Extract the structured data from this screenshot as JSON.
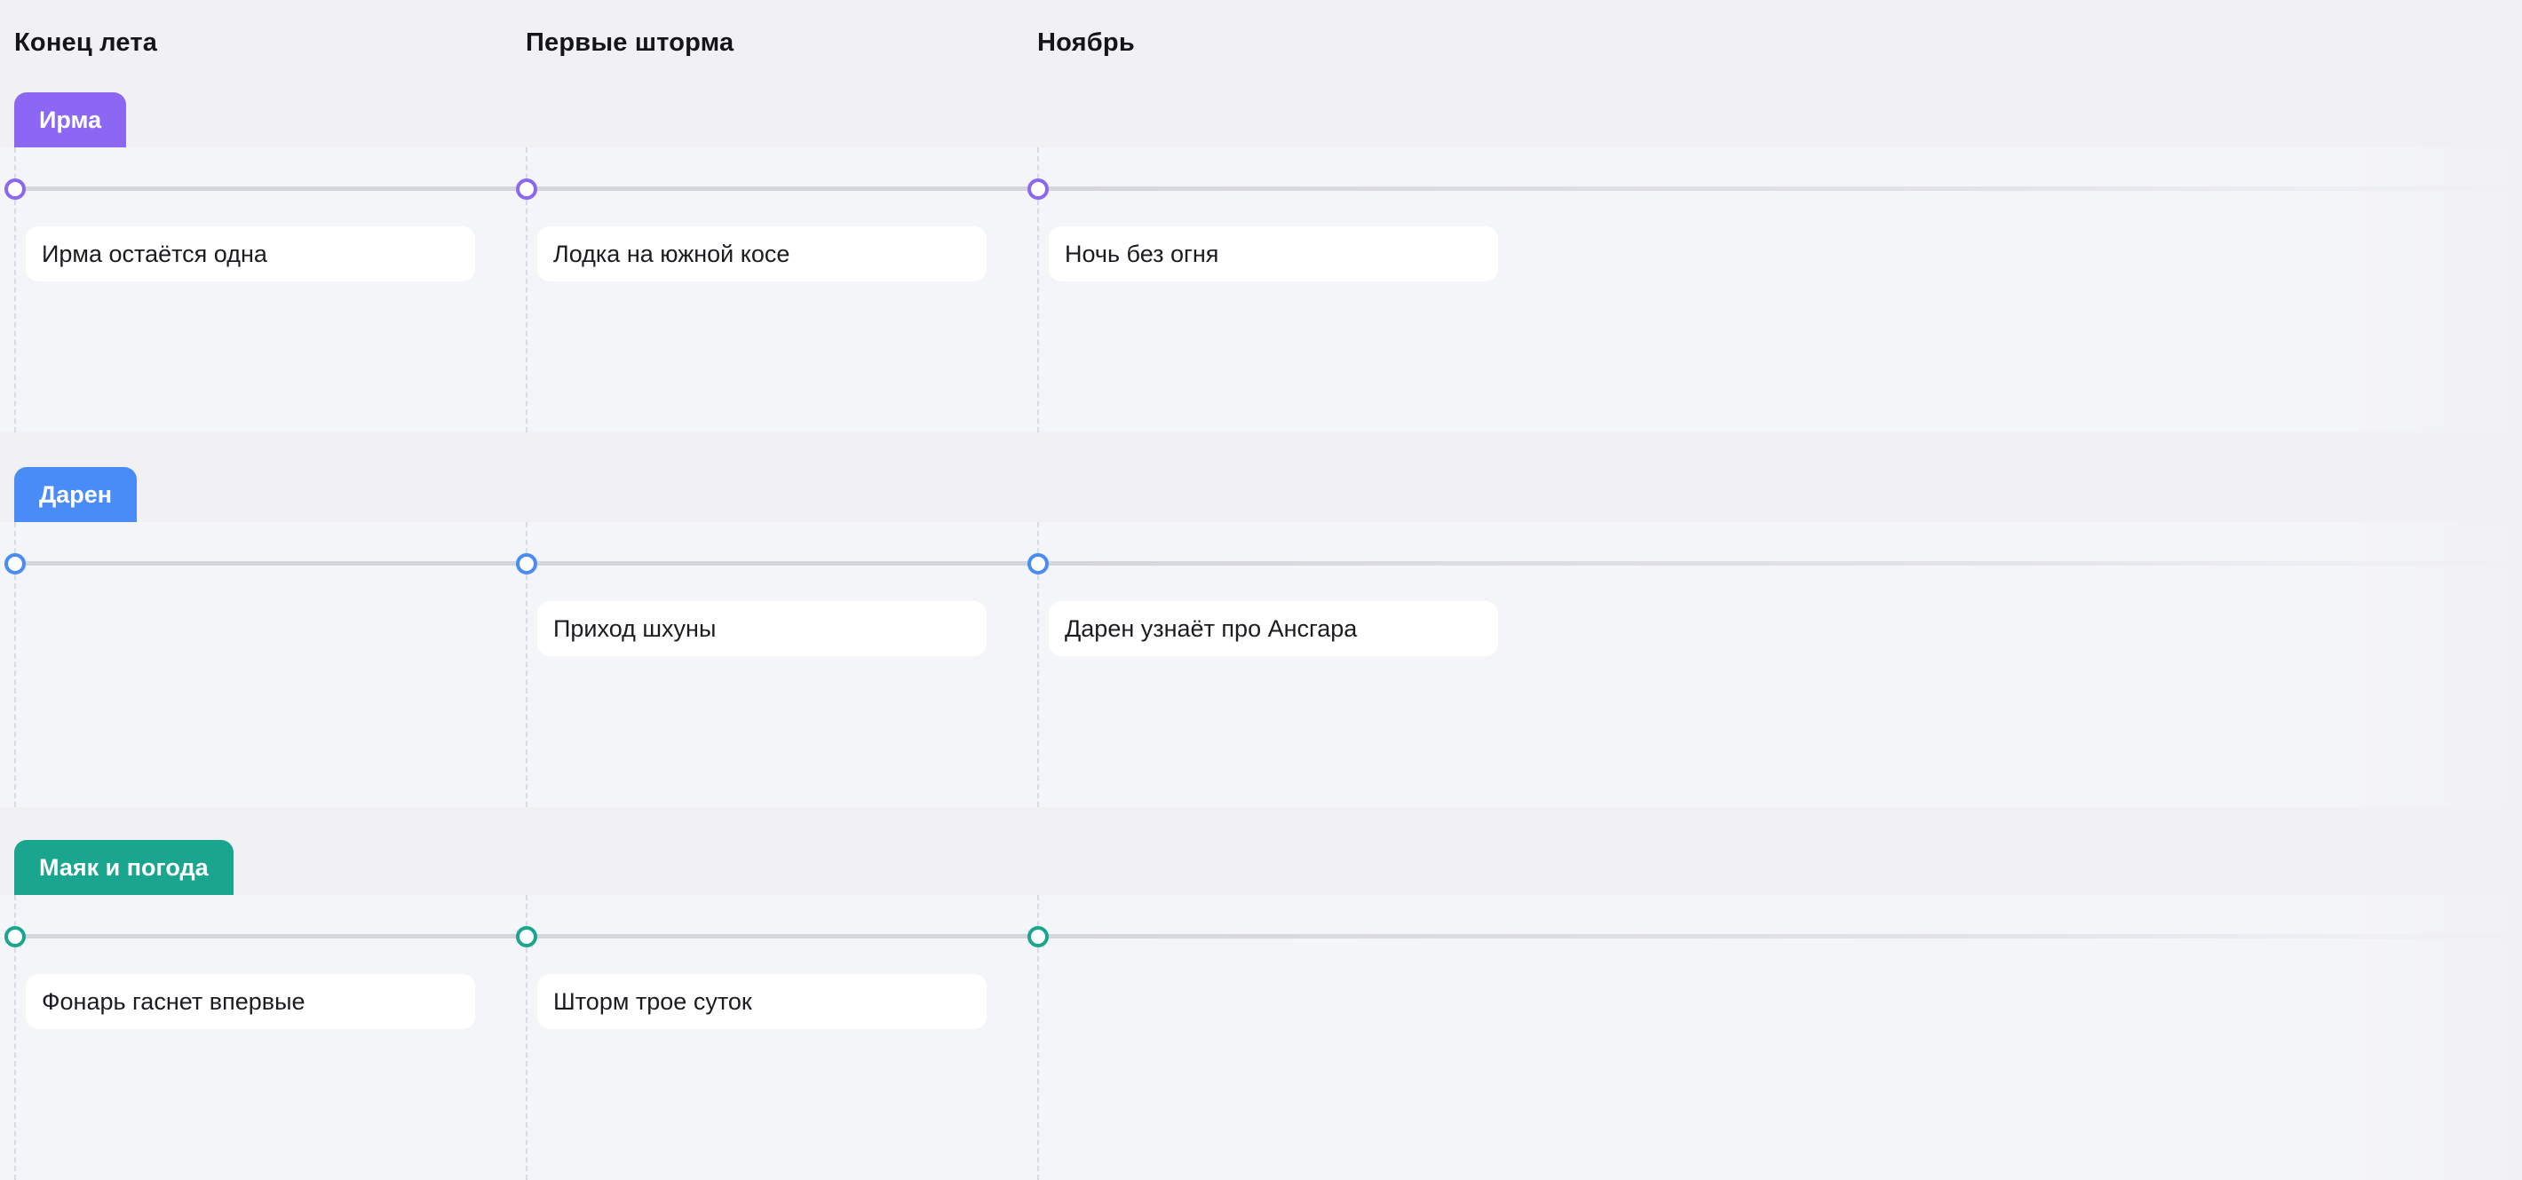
{
  "columns": [
    {
      "label": "Конец лета"
    },
    {
      "label": "Первые шторма"
    },
    {
      "label": "Ноябрь"
    }
  ],
  "lanes": [
    {
      "name": "Ирма",
      "color": "#8b67f4",
      "cards": [
        "Ирма остаётся одна",
        "Лодка на южной косе",
        "Ночь без огня"
      ]
    },
    {
      "name": "Дарен",
      "color": "#4a8cf7",
      "cards": [
        "",
        "Приход шхуны",
        "Дарен узнаёт про Ансгара"
      ]
    },
    {
      "name": "Маяк и погода",
      "color": "#1aa58f",
      "cards": [
        "Фонарь гаснет впервые",
        "Шторм трое суток",
        ""
      ]
    }
  ]
}
